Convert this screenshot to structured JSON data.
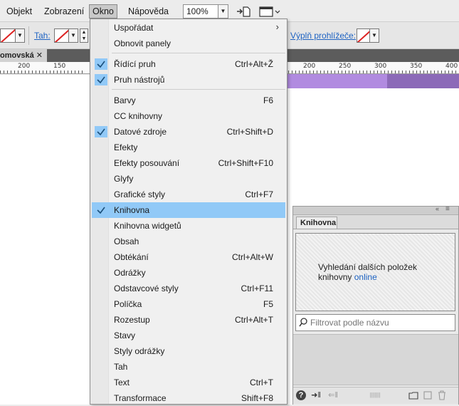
{
  "menubar": {
    "items": [
      {
        "label": "Objekt"
      },
      {
        "label": "Zobrazení"
      },
      {
        "label": "Okno"
      },
      {
        "label": "Nápověda"
      }
    ],
    "zoom": "100%"
  },
  "control_bar": {
    "stroke_label": "Tah:",
    "browser_fill_label": "Výplň prohlížeče:"
  },
  "document": {
    "tab_title": "omovská",
    "close_glyph": "✕",
    "ruler_labels": [
      "200",
      "150",
      "200",
      "250",
      "300",
      "350",
      "400"
    ]
  },
  "window_menu": {
    "highlight_color": "#91c9f7",
    "groups": [
      [
        {
          "label": "Uspořádat",
          "submenu": true,
          "checked": false,
          "shortcut": ""
        },
        {
          "label": "Obnovit panely",
          "checked": false,
          "shortcut": ""
        }
      ],
      [
        {
          "label": "Řídící pruh",
          "checked": true,
          "shortcut": "Ctrl+Alt+Ž"
        },
        {
          "label": "Pruh nástrojů",
          "checked": true,
          "shortcut": ""
        }
      ],
      [
        {
          "label": "Barvy",
          "checked": false,
          "shortcut": "F6"
        },
        {
          "label": "CC knihovny",
          "checked": false,
          "shortcut": ""
        },
        {
          "label": "Datové zdroje",
          "checked": true,
          "shortcut": "Ctrl+Shift+D"
        },
        {
          "label": "Efekty",
          "checked": false,
          "shortcut": ""
        },
        {
          "label": "Efekty posouvání",
          "checked": false,
          "shortcut": "Ctrl+Shift+F10"
        },
        {
          "label": "Glyfy",
          "checked": false,
          "shortcut": ""
        },
        {
          "label": "Grafické styly",
          "checked": false,
          "shortcut": "Ctrl+F7"
        },
        {
          "label": "Knihovna",
          "checked": true,
          "highlighted": true,
          "shortcut": ""
        },
        {
          "label": "Knihovna widgetů",
          "checked": false,
          "shortcut": ""
        },
        {
          "label": "Obsah",
          "checked": false,
          "shortcut": ""
        },
        {
          "label": "Obtékání",
          "checked": false,
          "shortcut": "Ctrl+Alt+W"
        },
        {
          "label": "Odrážky",
          "checked": false,
          "shortcut": ""
        },
        {
          "label": "Odstavcové styly",
          "checked": false,
          "shortcut": "Ctrl+F11"
        },
        {
          "label": "Políčka",
          "checked": false,
          "shortcut": "F5"
        },
        {
          "label": "Rozestup",
          "checked": false,
          "shortcut": "Ctrl+Alt+T"
        },
        {
          "label": "Stavy",
          "checked": false,
          "shortcut": ""
        },
        {
          "label": "Styly odrážky",
          "checked": false,
          "shortcut": ""
        },
        {
          "label": "Tah",
          "checked": false,
          "shortcut": ""
        },
        {
          "label": "Text",
          "checked": false,
          "shortcut": "Ctrl+T"
        },
        {
          "label": "Transformace",
          "checked": false,
          "shortcut": "Shift+F8"
        }
      ]
    ]
  },
  "library_panel": {
    "collapse_glyph": "«",
    "tab_label": "Knihovna",
    "message": "Vyhledání dalších položek knihovny",
    "link": "online",
    "filter_placeholder": "Filtrovat podle názvu",
    "footer_icons": [
      "help-icon",
      "import-icon",
      "export-icon",
      "folder-icon",
      "new-item-icon",
      "trash-icon"
    ]
  }
}
